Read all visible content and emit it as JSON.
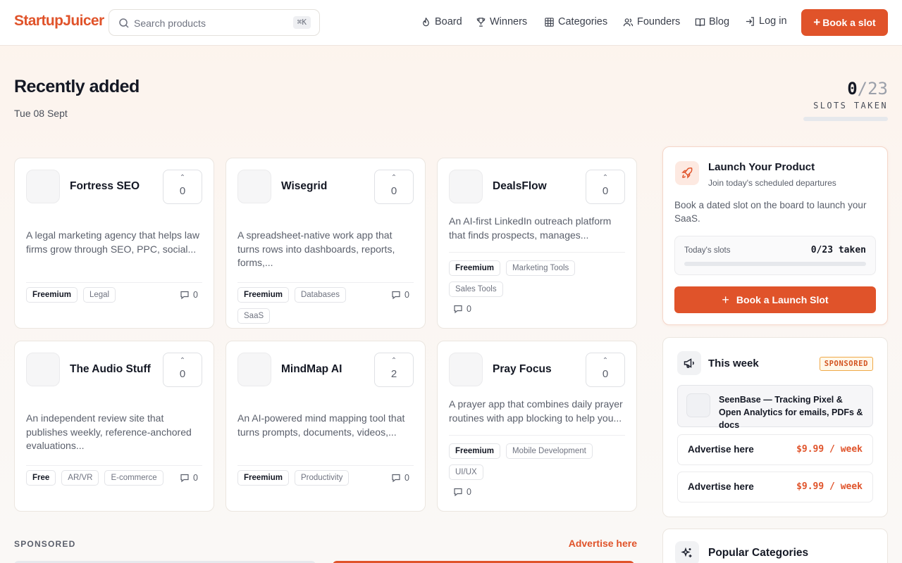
{
  "header": {
    "logo": "StartupJuicer",
    "search_placeholder": "Search products",
    "search_shortcut": "⌘K",
    "nav": {
      "board": "Board",
      "winners": "Winners",
      "categories": "Categories",
      "founders": "Founders",
      "blog": "Blog",
      "login": "Log in"
    },
    "book_button": "Book a slot"
  },
  "page": {
    "title": "Recently added",
    "date": "Tue 08 Sept",
    "slots_taken": "0",
    "slots_total": "/23",
    "slots_label": "SLOTS TAKEN",
    "slots_fraction": 0
  },
  "products": [
    {
      "name": "Fortress SEO",
      "votes": "0",
      "description": "A legal marketing agency that helps law firms grow through SEO, PPC, social...",
      "pricing": "Freemium",
      "tags": [
        "Legal"
      ],
      "comments": "0"
    },
    {
      "name": "Wisegrid",
      "votes": "0",
      "description": "A spreadsheet-native work app that turns rows into dashboards, reports, forms,...",
      "pricing": "Freemium",
      "tags": [
        "Databases",
        "SaaS"
      ],
      "comments": "0"
    },
    {
      "name": "DealsFlow",
      "votes": "0",
      "description": "An AI-first LinkedIn outreach platform that finds prospects, manages...",
      "pricing": "Freemium",
      "tags": [
        "Marketing Tools",
        "Sales Tools"
      ],
      "comments": "0"
    },
    {
      "name": "The Audio Stuff",
      "votes": "0",
      "description": "An independent review site that publishes weekly, reference-anchored evaluations...",
      "pricing": "Free",
      "tags": [
        "AR/VR",
        "E-commerce"
      ],
      "comments": "0"
    },
    {
      "name": "MindMap AI",
      "votes": "2",
      "description": "An AI-powered mind mapping tool that turns prompts, documents, videos,...",
      "pricing": "Freemium",
      "tags": [
        "Productivity"
      ],
      "comments": "0"
    },
    {
      "name": "Pray Focus",
      "votes": "0",
      "description": "A prayer app that combines daily prayer routines with app blocking to help you...",
      "pricing": "Freemium",
      "tags": [
        "Mobile Development",
        "UI/UX"
      ],
      "comments": "0"
    }
  ],
  "sponsored": {
    "label": "SPONSORED",
    "advertise_link": "Advertise here"
  },
  "launch_panel": {
    "title": "Launch Your Product",
    "subtitle": "Join today's scheduled departures",
    "body": "Book a dated slot on the board to launch your SaaS.",
    "slots_label": "Today's slots",
    "slots_value": "0/23 taken",
    "slots_fraction": 0,
    "cta": "Book a Launch Slot"
  },
  "week_panel": {
    "title": "This week",
    "badge": "SPONSORED",
    "featured": "SeenBase — Tracking Pixel & Open Analytics for emails, PDFs & docs",
    "ads": [
      {
        "label": "Advertise here",
        "price": "$9.99 / week"
      },
      {
        "label": "Advertise here",
        "price": "$9.99 / week"
      }
    ]
  },
  "popular_panel": {
    "title": "Popular Categories"
  },
  "colors": {
    "accent": "#e0532a",
    "badge_border": "#f0a948"
  },
  "icons": [
    "search-icon",
    "flame-icon",
    "trophy-icon",
    "grid-icon",
    "users-icon",
    "book-icon",
    "login-icon",
    "rocket-icon",
    "megaphone-icon",
    "sparkles-icon",
    "comment-icon",
    "upvote-icon"
  ]
}
